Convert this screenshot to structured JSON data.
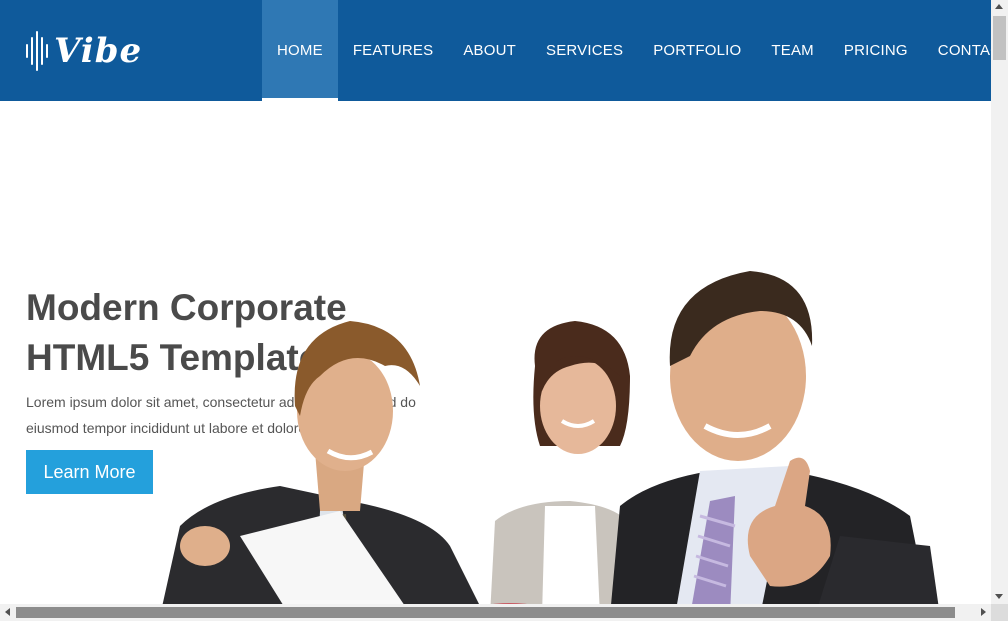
{
  "brand": {
    "name": "Vibe",
    "logo_icon": "sound-wave-icon"
  },
  "nav": {
    "items": [
      {
        "label": "HOME",
        "active": true
      },
      {
        "label": "FEATURES",
        "active": false
      },
      {
        "label": "ABOUT",
        "active": false
      },
      {
        "label": "SERVICES",
        "active": false
      },
      {
        "label": "PORTFOLIO",
        "active": false
      },
      {
        "label": "TEAM",
        "active": false
      },
      {
        "label": "PRICING",
        "active": false
      },
      {
        "label": "CONTACT",
        "active": false
      }
    ]
  },
  "hero": {
    "title_line1": "Modern Corporate",
    "title_line2": "HTML5 Template",
    "text": "Lorem ipsum dolor sit amet, consectetur adipisicing elit, sed do eiusmod tempor incididunt ut labore et dolore",
    "button_label": "Learn More"
  },
  "colors": {
    "header_bg": "#0f5a9b",
    "nav_active_bg": "#2f78b4",
    "button_bg": "#24a0dc",
    "title_color": "#4a4a4a"
  }
}
